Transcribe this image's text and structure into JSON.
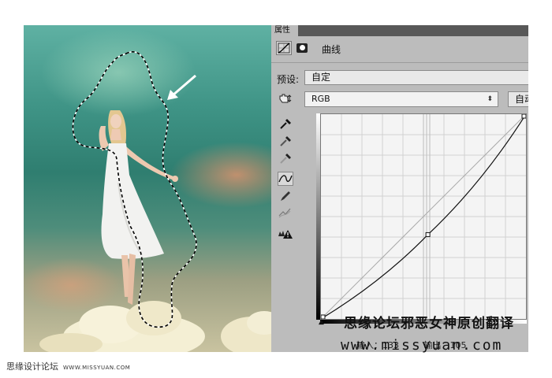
{
  "panel": {
    "tab_label": "属性",
    "adjustment_title": "曲线",
    "preset_label": "预设:",
    "preset_value": "自定",
    "channel_value": "RGB",
    "auto_label": "自动",
    "input_label": "输入：133",
    "output_label": "输出：105",
    "icons": [
      "curves-adjustment-icon",
      "mask-icon",
      "on-image-adjust-hand-icon",
      "black-eyedropper-icon",
      "gray-eyedropper-icon",
      "white-eyedropper-icon",
      "curve-point-tool-icon",
      "pencil-draw-icon",
      "smooth-curve-icon",
      "clipping-warning-icon"
    ]
  },
  "curve": {
    "points_in": [
      0,
      133,
      255
    ],
    "points_out": [
      0,
      105,
      255
    ],
    "selected_point": 1
  },
  "watermark": {
    "line1": "思缘论坛邪恶女神原创翻译",
    "line2": "www.missyuan.com"
  },
  "footer": {
    "site_name": "思缘设计论坛",
    "site_url": "WWW.MISSYUAN.COM"
  }
}
